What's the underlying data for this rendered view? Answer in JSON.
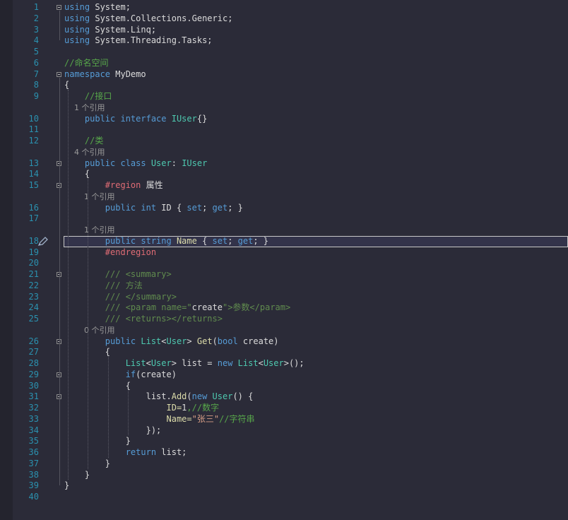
{
  "editor": {
    "lines": [
      {
        "n": "1",
        "tokens": [
          {
            "t": "using ",
            "c": "kw"
          },
          {
            "t": "System;",
            "c": ""
          }
        ]
      },
      {
        "n": "2",
        "tokens": [
          {
            "t": "using ",
            "c": "kw"
          },
          {
            "t": "System.Collections.Generic;",
            "c": ""
          }
        ]
      },
      {
        "n": "3",
        "tokens": [
          {
            "t": "using ",
            "c": "kw"
          },
          {
            "t": "System.Linq;",
            "c": ""
          }
        ]
      },
      {
        "n": "4",
        "tokens": [
          {
            "t": "using ",
            "c": "kw"
          },
          {
            "t": "System.Threading.Tasks;",
            "c": ""
          }
        ]
      },
      {
        "n": "5",
        "tokens": []
      },
      {
        "n": "6",
        "tokens": [
          {
            "t": "//命名空间",
            "c": "cm"
          }
        ]
      },
      {
        "n": "7",
        "tokens": [
          {
            "t": "namespace ",
            "c": "kw"
          },
          {
            "t": "MyDemo",
            "c": ""
          }
        ]
      },
      {
        "n": "8",
        "tokens": [
          {
            "t": "{",
            "c": ""
          }
        ]
      },
      {
        "n": "9",
        "tokens": [
          {
            "t": "    //接口",
            "c": "cm"
          }
        ]
      },
      {
        "n": "",
        "ref": true,
        "tokens": [
          {
            "t": "    1 个引用",
            "c": "ref"
          }
        ]
      },
      {
        "n": "10",
        "tokens": [
          {
            "t": "    public interface ",
            "c": "kw"
          },
          {
            "t": "IUser",
            "c": "ty"
          },
          {
            "t": "{}",
            "c": ""
          }
        ]
      },
      {
        "n": "11",
        "tokens": []
      },
      {
        "n": "12",
        "tokens": [
          {
            "t": "    //类",
            "c": "cm"
          }
        ]
      },
      {
        "n": "",
        "ref": true,
        "tokens": [
          {
            "t": "    4 个引用",
            "c": "ref"
          }
        ]
      },
      {
        "n": "13",
        "tokens": [
          {
            "t": "    public class ",
            "c": "kw"
          },
          {
            "t": "User",
            "c": "ty"
          },
          {
            "t": ": ",
            "c": ""
          },
          {
            "t": "IUser",
            "c": "ty"
          }
        ]
      },
      {
        "n": "14",
        "tokens": [
          {
            "t": "    {",
            "c": ""
          }
        ]
      },
      {
        "n": "15",
        "tokens": [
          {
            "t": "        #region ",
            "c": "pp"
          },
          {
            "t": "属性",
            "c": ""
          }
        ]
      },
      {
        "n": "",
        "ref": true,
        "tokens": [
          {
            "t": "        1 个引用",
            "c": "ref"
          }
        ]
      },
      {
        "n": "16",
        "tokens": [
          {
            "t": "        public int ",
            "c": "kw"
          },
          {
            "t": "ID { ",
            "c": ""
          },
          {
            "t": "set",
            "c": "kw"
          },
          {
            "t": "; ",
            "c": ""
          },
          {
            "t": "get",
            "c": "kw"
          },
          {
            "t": "; }",
            "c": ""
          }
        ]
      },
      {
        "n": "17",
        "tokens": []
      },
      {
        "n": "",
        "ref": true,
        "tokens": [
          {
            "t": "        1 个引用",
            "c": "ref"
          }
        ]
      },
      {
        "n": "18",
        "tokens": [
          {
            "t": "        public string ",
            "c": "kw"
          },
          {
            "t": "Name ",
            "c": "fn"
          },
          {
            "t": "{ ",
            "c": ""
          },
          {
            "t": "set",
            "c": "kw"
          },
          {
            "t": "; ",
            "c": ""
          },
          {
            "t": "get",
            "c": "kw"
          },
          {
            "t": "; }",
            "c": ""
          }
        ]
      },
      {
        "n": "19",
        "tokens": [
          {
            "t": "        #endregion",
            "c": "pp"
          }
        ]
      },
      {
        "n": "20",
        "tokens": []
      },
      {
        "n": "21",
        "tokens": [
          {
            "t": "        /// <summary>",
            "c": "xd"
          }
        ]
      },
      {
        "n": "22",
        "tokens": [
          {
            "t": "        /// 方法",
            "c": "xd"
          }
        ]
      },
      {
        "n": "23",
        "tokens": [
          {
            "t": "        /// </summary>",
            "c": "xd"
          }
        ]
      },
      {
        "n": "24",
        "tokens": [
          {
            "t": "        /// <param name=\"",
            "c": "xd"
          },
          {
            "t": "create",
            "c": ""
          },
          {
            "t": "\">参数</param>",
            "c": "xd"
          }
        ]
      },
      {
        "n": "25",
        "tokens": [
          {
            "t": "        /// <returns></returns>",
            "c": "xd"
          }
        ]
      },
      {
        "n": "",
        "ref": true,
        "tokens": [
          {
            "t": "        0 个引用",
            "c": "ref"
          }
        ]
      },
      {
        "n": "26",
        "tokens": [
          {
            "t": "        public ",
            "c": "kw"
          },
          {
            "t": "List",
            "c": "ty"
          },
          {
            "t": "<",
            "c": ""
          },
          {
            "t": "User",
            "c": "ty"
          },
          {
            "t": "> ",
            "c": ""
          },
          {
            "t": "Get",
            "c": "fn"
          },
          {
            "t": "(",
            "c": ""
          },
          {
            "t": "bool ",
            "c": "kw"
          },
          {
            "t": "create)",
            "c": ""
          }
        ]
      },
      {
        "n": "27",
        "tokens": [
          {
            "t": "        {",
            "c": ""
          }
        ]
      },
      {
        "n": "28",
        "tokens": [
          {
            "t": "            List",
            "c": "ty"
          },
          {
            "t": "<",
            "c": ""
          },
          {
            "t": "User",
            "c": "ty"
          },
          {
            "t": "> list = ",
            "c": ""
          },
          {
            "t": "new ",
            "c": "kw"
          },
          {
            "t": "List",
            "c": "ty"
          },
          {
            "t": "<",
            "c": ""
          },
          {
            "t": "User",
            "c": "ty"
          },
          {
            "t": ">();",
            "c": ""
          }
        ]
      },
      {
        "n": "29",
        "tokens": [
          {
            "t": "            if",
            "c": "kw"
          },
          {
            "t": "(create)",
            "c": ""
          }
        ]
      },
      {
        "n": "30",
        "tokens": [
          {
            "t": "            {",
            "c": ""
          }
        ]
      },
      {
        "n": "31",
        "tokens": [
          {
            "t": "                list.",
            "c": ""
          },
          {
            "t": "Add",
            "c": "fn"
          },
          {
            "t": "(",
            "c": ""
          },
          {
            "t": "new ",
            "c": "kw"
          },
          {
            "t": "User",
            "c": "ty"
          },
          {
            "t": "() {",
            "c": ""
          }
        ]
      },
      {
        "n": "32",
        "tokens": [
          {
            "t": "                    ID=",
            "c": "fn"
          },
          {
            "t": "1",
            "c": ""
          },
          {
            "t": ",//数字",
            "c": "cm"
          }
        ]
      },
      {
        "n": "33",
        "tokens": [
          {
            "t": "                    Name=",
            "c": "fn"
          },
          {
            "t": "\"张三\"",
            "c": "st"
          },
          {
            "t": "//字符串",
            "c": "cm"
          }
        ]
      },
      {
        "n": "34",
        "tokens": [
          {
            "t": "                });",
            "c": ""
          }
        ]
      },
      {
        "n": "35",
        "tokens": [
          {
            "t": "            }",
            "c": ""
          }
        ]
      },
      {
        "n": "36",
        "tokens": [
          {
            "t": "            return ",
            "c": "kw"
          },
          {
            "t": "list;",
            "c": ""
          }
        ]
      },
      {
        "n": "37",
        "tokens": [
          {
            "t": "        }",
            "c": ""
          }
        ]
      },
      {
        "n": "38",
        "tokens": [
          {
            "t": "    }",
            "c": ""
          }
        ]
      },
      {
        "n": "39",
        "tokens": [
          {
            "t": "}",
            "c": ""
          }
        ]
      },
      {
        "n": "40",
        "tokens": []
      }
    ],
    "fold_marker_lines": [
      "1",
      "7",
      "13",
      "15",
      "21",
      "26",
      "29",
      "31"
    ],
    "active_line": "18",
    "edit_glyph": "pencil-icon"
  }
}
